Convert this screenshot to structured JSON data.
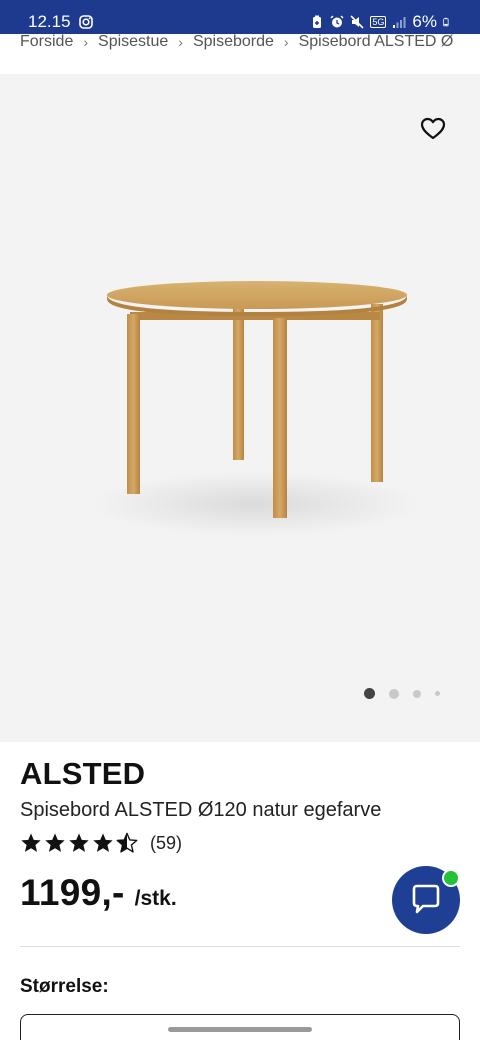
{
  "status_bar": {
    "time": "12.15",
    "network": "5G",
    "battery": "6%",
    "icons": [
      "instagram-icon",
      "battery-saver-icon",
      "alarm-icon",
      "mute-icon",
      "signal-icon",
      "battery-icon"
    ]
  },
  "breadcrumb": {
    "items": [
      "Forside",
      "Spisestue",
      "Spiseborde",
      "Spisebord ALSTED Ø"
    ],
    "separator": "›"
  },
  "product": {
    "brand": "ALSTED",
    "name": "Spisebord ALSTED Ø120 natur egefarve",
    "rating": 4.5,
    "rating_count": "(59)",
    "price": "1199,-",
    "unit": "/stk.",
    "image_count": 4,
    "active_image": 1
  },
  "options": {
    "size_label": "Størrelse:"
  },
  "colors": {
    "status_bar": "#1d3a8f",
    "chat_button": "#1f3f94",
    "online_dot": "#22c23a",
    "hero_bg": "#f3f3f3"
  }
}
